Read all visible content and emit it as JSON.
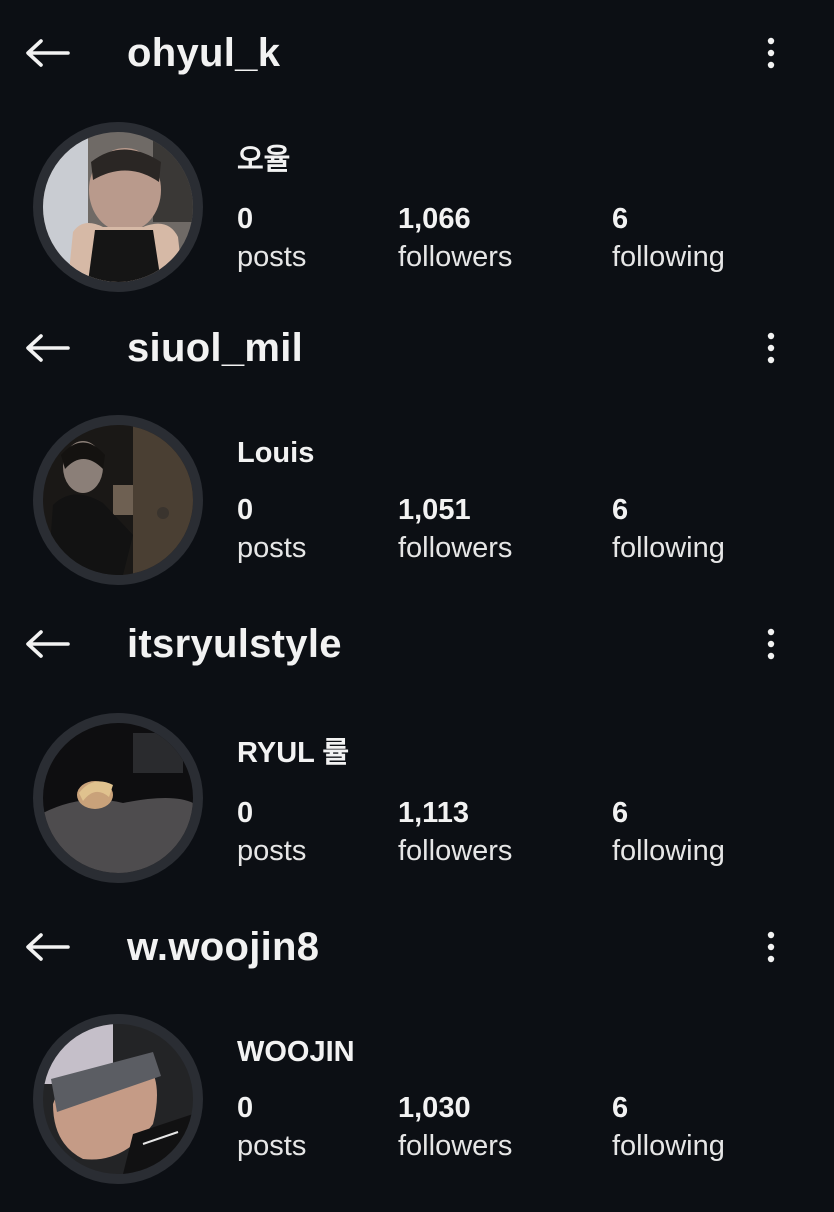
{
  "profiles": [
    {
      "username": "ohyul_k",
      "display_name": "오율",
      "posts": "0",
      "posts_label": "posts",
      "followers": "1,066",
      "followers_label": "followers",
      "following": "6",
      "following_label": "following"
    },
    {
      "username": "siuol_mil",
      "display_name": "Louis",
      "posts": "0",
      "posts_label": "posts",
      "followers": "1,051",
      "followers_label": "followers",
      "following": "6",
      "following_label": "following"
    },
    {
      "username": "itsryulstyle",
      "display_name": "RYUL 률",
      "posts": "0",
      "posts_label": "posts",
      "followers": "1,113",
      "followers_label": "followers",
      "following": "6",
      "following_label": "following"
    },
    {
      "username": "w.woojin8",
      "display_name": "WOOJIN",
      "posts": "0",
      "posts_label": "posts",
      "followers": "1,030",
      "followers_label": "followers",
      "following": "6",
      "following_label": "following"
    }
  ],
  "icons": {
    "back": "back-arrow-icon",
    "more": "more-options-icon"
  },
  "colors": {
    "background": "#0c0f14",
    "text": "#f2f2f2",
    "avatar_ring": "#2a2d33"
  }
}
